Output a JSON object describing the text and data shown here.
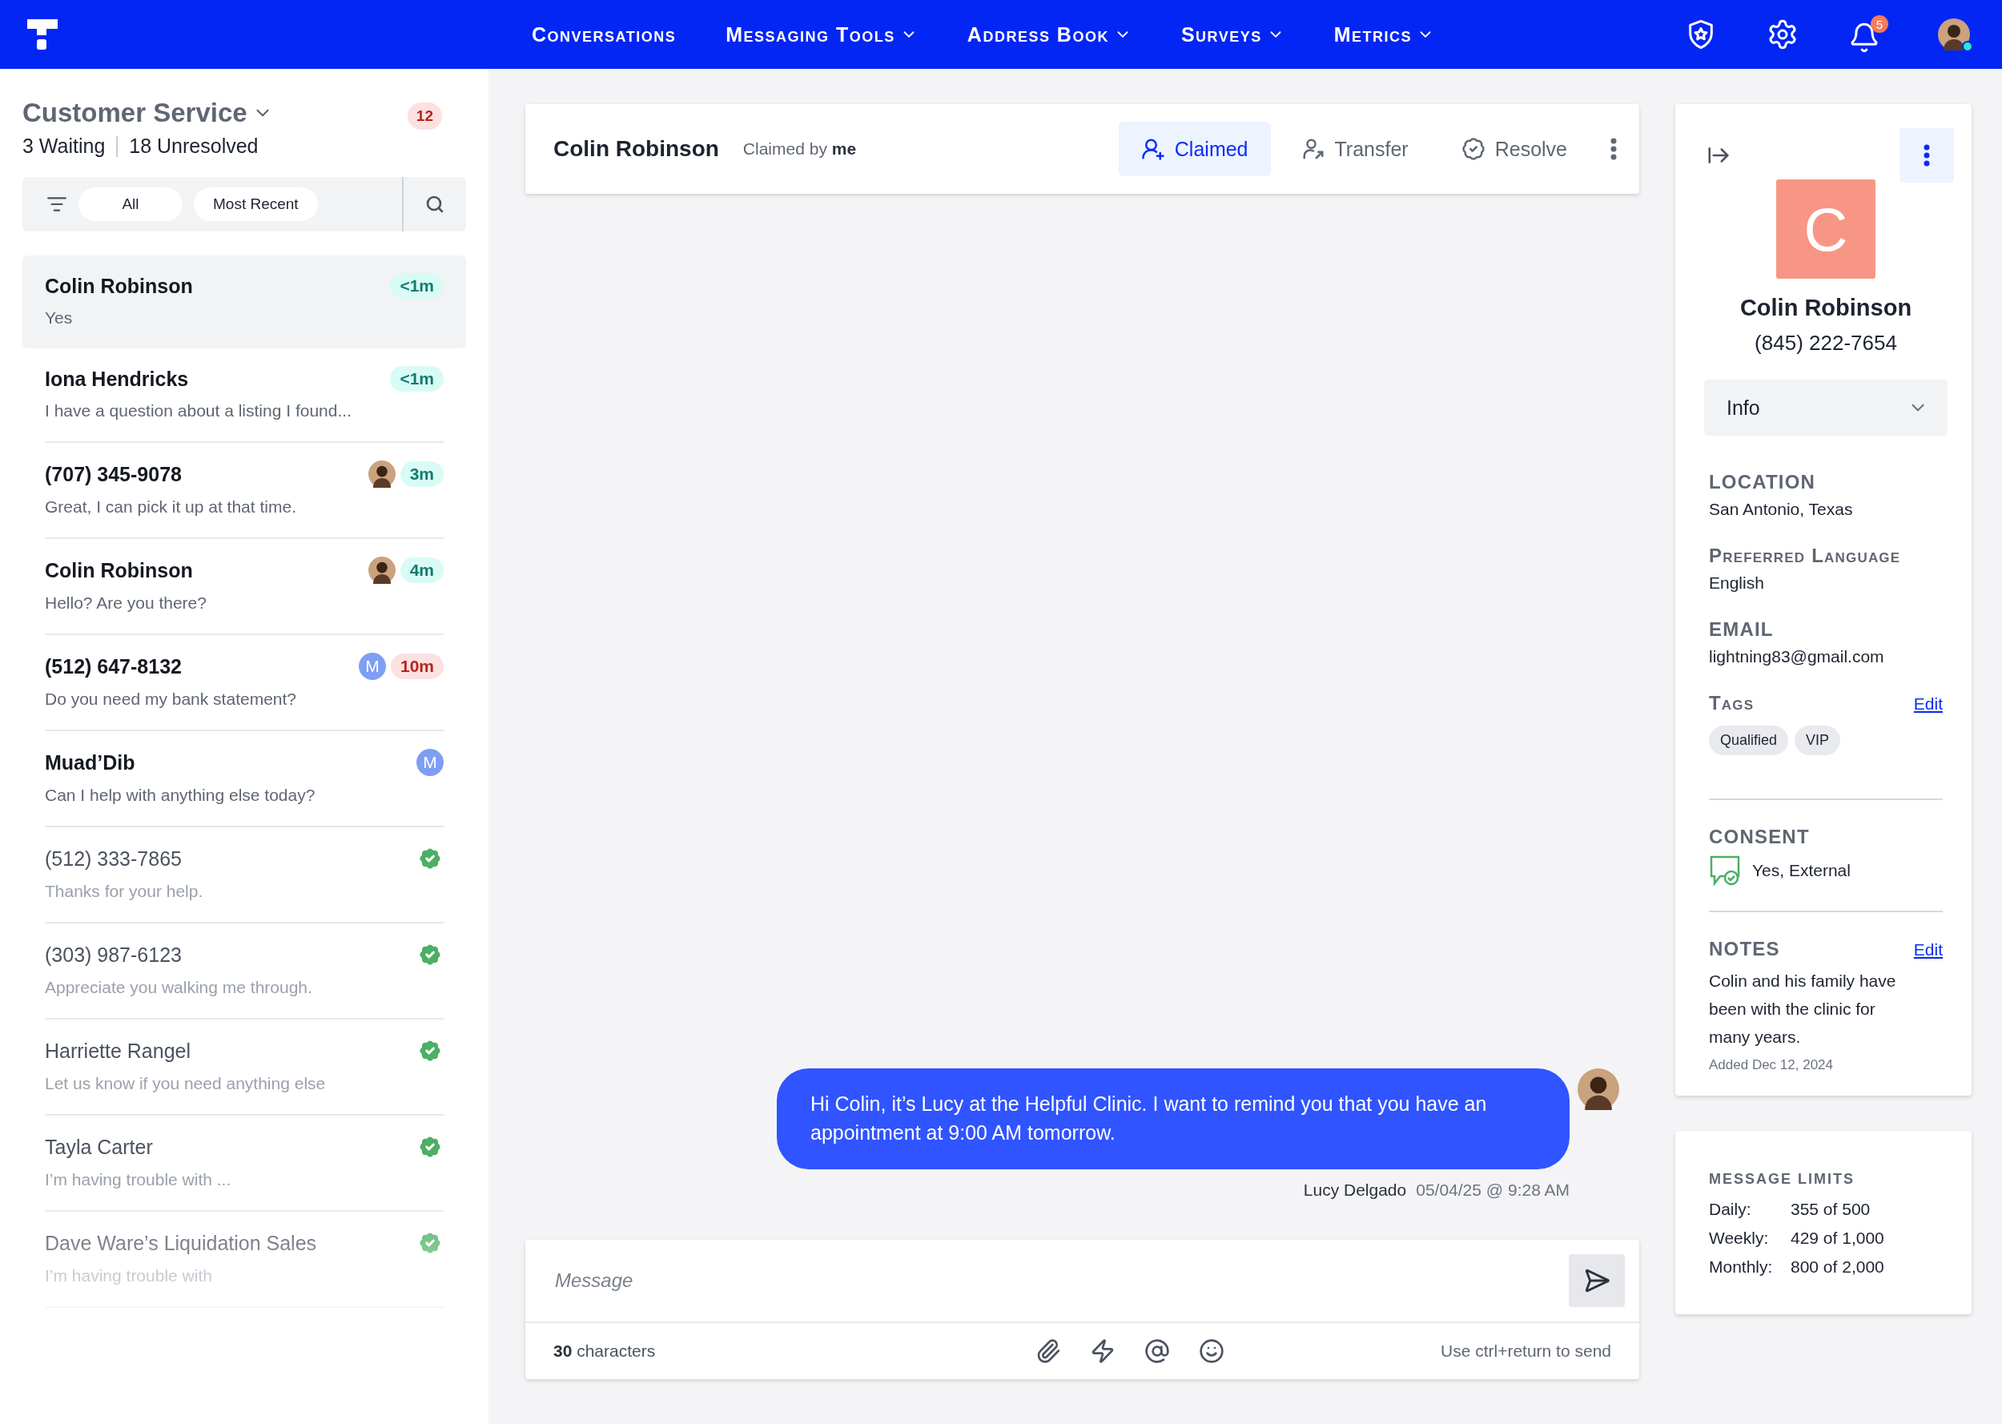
{
  "nav": {
    "items": [
      {
        "label": "Conversations",
        "dropdown": false
      },
      {
        "label": "Messaging Tools",
        "dropdown": true
      },
      {
        "label": "Address Book",
        "dropdown": true
      },
      {
        "label": "Surveys",
        "dropdown": true
      },
      {
        "label": "Metrics",
        "dropdown": true
      }
    ],
    "notification_count": "5",
    "online": true
  },
  "sidebar": {
    "title": "Customer Service",
    "count": "12",
    "waiting_count": "3",
    "waiting_label": "Waiting",
    "unresolved_count": "18",
    "unresolved_label": "Unresolved",
    "filters": [
      "All",
      "Most Recent"
    ],
    "conversations": [
      {
        "name": "Colin Robinson",
        "preview": "Yes",
        "selected": true,
        "resolved": false,
        "time": "<1m",
        "urgent": false
      },
      {
        "name": "Iona Hendricks",
        "preview": "I have a question about a listing I found...",
        "selected": false,
        "resolved": false,
        "time": "<1m",
        "urgent": false
      },
      {
        "name": "(707) 345-9078",
        "preview": "Great, I can pick it up at that time.",
        "selected": false,
        "resolved": false,
        "time": "3m",
        "urgent": false,
        "agent": {
          "kind": "photo"
        }
      },
      {
        "name": "Colin Robinson",
        "preview": "Hello? Are you there?",
        "selected": false,
        "resolved": false,
        "time": "4m",
        "urgent": false,
        "agent": {
          "kind": "photo"
        }
      },
      {
        "name": "(512) 647-8132",
        "preview": "Do you need my bank statement?",
        "selected": false,
        "resolved": false,
        "time": "10m",
        "urgent": true,
        "agent": {
          "kind": "initial",
          "initial": "M"
        }
      },
      {
        "name": "Muad’Dib",
        "preview": "Can I help with anything else today?",
        "selected": false,
        "resolved": false,
        "agent": {
          "kind": "initial",
          "initial": "M"
        }
      },
      {
        "name": "(512) 333-7865",
        "preview": "Thanks for your help.",
        "selected": false,
        "resolved": true
      },
      {
        "name": "(303) 987-6123",
        "preview": "Appreciate you walking me through.",
        "selected": false,
        "resolved": true
      },
      {
        "name": "Harriette Rangel",
        "preview": "Let us know if you need anything else",
        "selected": false,
        "resolved": true
      },
      {
        "name": "Tayla Carter",
        "preview": "I’m having trouble with ...",
        "selected": false,
        "resolved": true
      },
      {
        "name": "Dave Ware’s Liquidation Sales",
        "preview": "I’m having trouble with",
        "selected": false,
        "resolved": true
      }
    ]
  },
  "conversation": {
    "name": "Colin Robinson",
    "claim": "Claimed by **me**",
    "actions": [
      {
        "label": "Claimed",
        "kind": "claim",
        "selected": true
      },
      {
        "label": "Transfer",
        "kind": "transfer",
        "selected": false
      },
      {
        "label": "Resolve",
        "kind": "resolve",
        "selected": false
      }
    ],
    "messages": [
      {
        "text": "Hi Colin, it’s Lucy at the Helpful Clinic. I want to remind you that you have an appointment at 9:00 AM tomorrow.",
        "author": "Lucy Delgado",
        "timestamp": "05/04/25 @ 9:28 AM"
      }
    ],
    "composer": {
      "placeholder": "Message",
      "count": "**30** characters",
      "hint": "Use ctrl+return to send"
    }
  },
  "contact": {
    "initial": "C",
    "name": "Colin Robinson",
    "phone": "(845) 222-7654",
    "section": "Info",
    "fields": [
      {
        "label": "LOCATION",
        "value": "San Antonio, Texas"
      },
      {
        "label": "Preferred Language",
        "value": "English"
      },
      {
        "label": "EMAIL",
        "value": "lightning83@gmail.com"
      }
    ],
    "tags": {
      "label": "Tags",
      "edit": "Edit",
      "items": [
        "Qualified",
        "VIP"
      ]
    },
    "consent": {
      "label": "CONSENT",
      "value": "Yes, External"
    },
    "notes": {
      "label": "NOTES",
      "edit": "Edit",
      "text": "Colin and his family have been with the clinic for many years.",
      "added": "Added Dec 12, 2024"
    }
  },
  "message_limits": {
    "title": "MESSAGE LIMITS",
    "rows": [
      {
        "label": "Daily:",
        "value": "355 of 500"
      },
      {
        "label": "Weekly:",
        "value": "429 of 1,000"
      },
      {
        "label": "Monthly:",
        "value": "800 of 2,000"
      }
    ]
  }
}
